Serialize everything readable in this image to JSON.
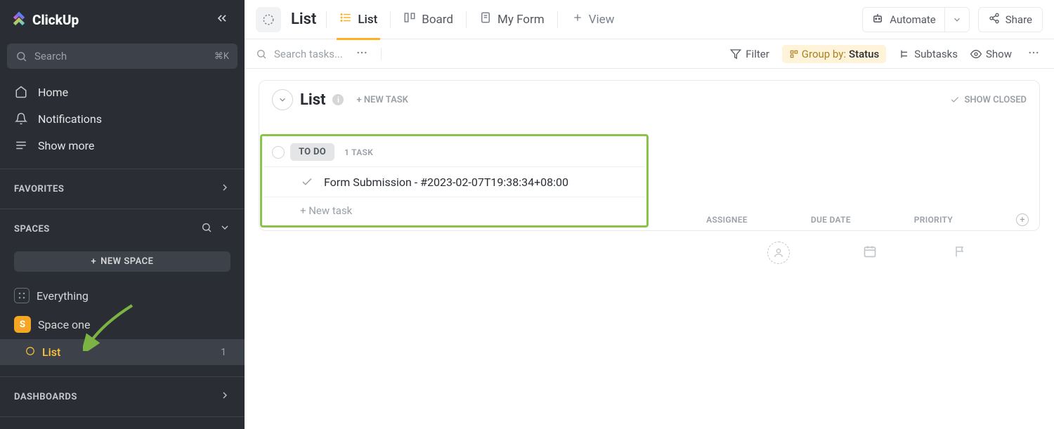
{
  "sidebar": {
    "logo_text": "ClickUp",
    "search_placeholder": "Search",
    "search_kbd": "⌘K",
    "nav": {
      "home": "Home",
      "notifications": "Notifications",
      "show_more": "Show more"
    },
    "sections": {
      "favorites": "FAVORITES",
      "spaces": "SPACES",
      "dashboards": "DASHBOARDS"
    },
    "new_space": "NEW SPACE",
    "tree": {
      "everything": "Everything",
      "space_one_badge": "S",
      "space_one": "Space one",
      "list": "List",
      "list_count": "1"
    }
  },
  "header": {
    "title": "List",
    "tabs": {
      "list": "List",
      "board": "Board",
      "my_form": "My Form"
    },
    "view": "View",
    "automate": "Automate",
    "share": "Share"
  },
  "toolbar": {
    "search_placeholder": "Search tasks...",
    "filter": "Filter",
    "group_by_label": "Group by:",
    "group_by_value": "Status",
    "subtasks": "Subtasks",
    "show": "Show"
  },
  "content": {
    "list_name": "List",
    "new_task_top": "+ NEW TASK",
    "show_closed": "SHOW CLOSED",
    "status_label": "TO DO",
    "task_count_label": "1 TASK",
    "columns": {
      "assignee": "ASSIGNEE",
      "due_date": "DUE DATE",
      "priority": "PRIORITY"
    },
    "task_name": "Form Submission - #2023-02-07T19:38:34+08:00",
    "new_task_bottom": "+ New task"
  }
}
